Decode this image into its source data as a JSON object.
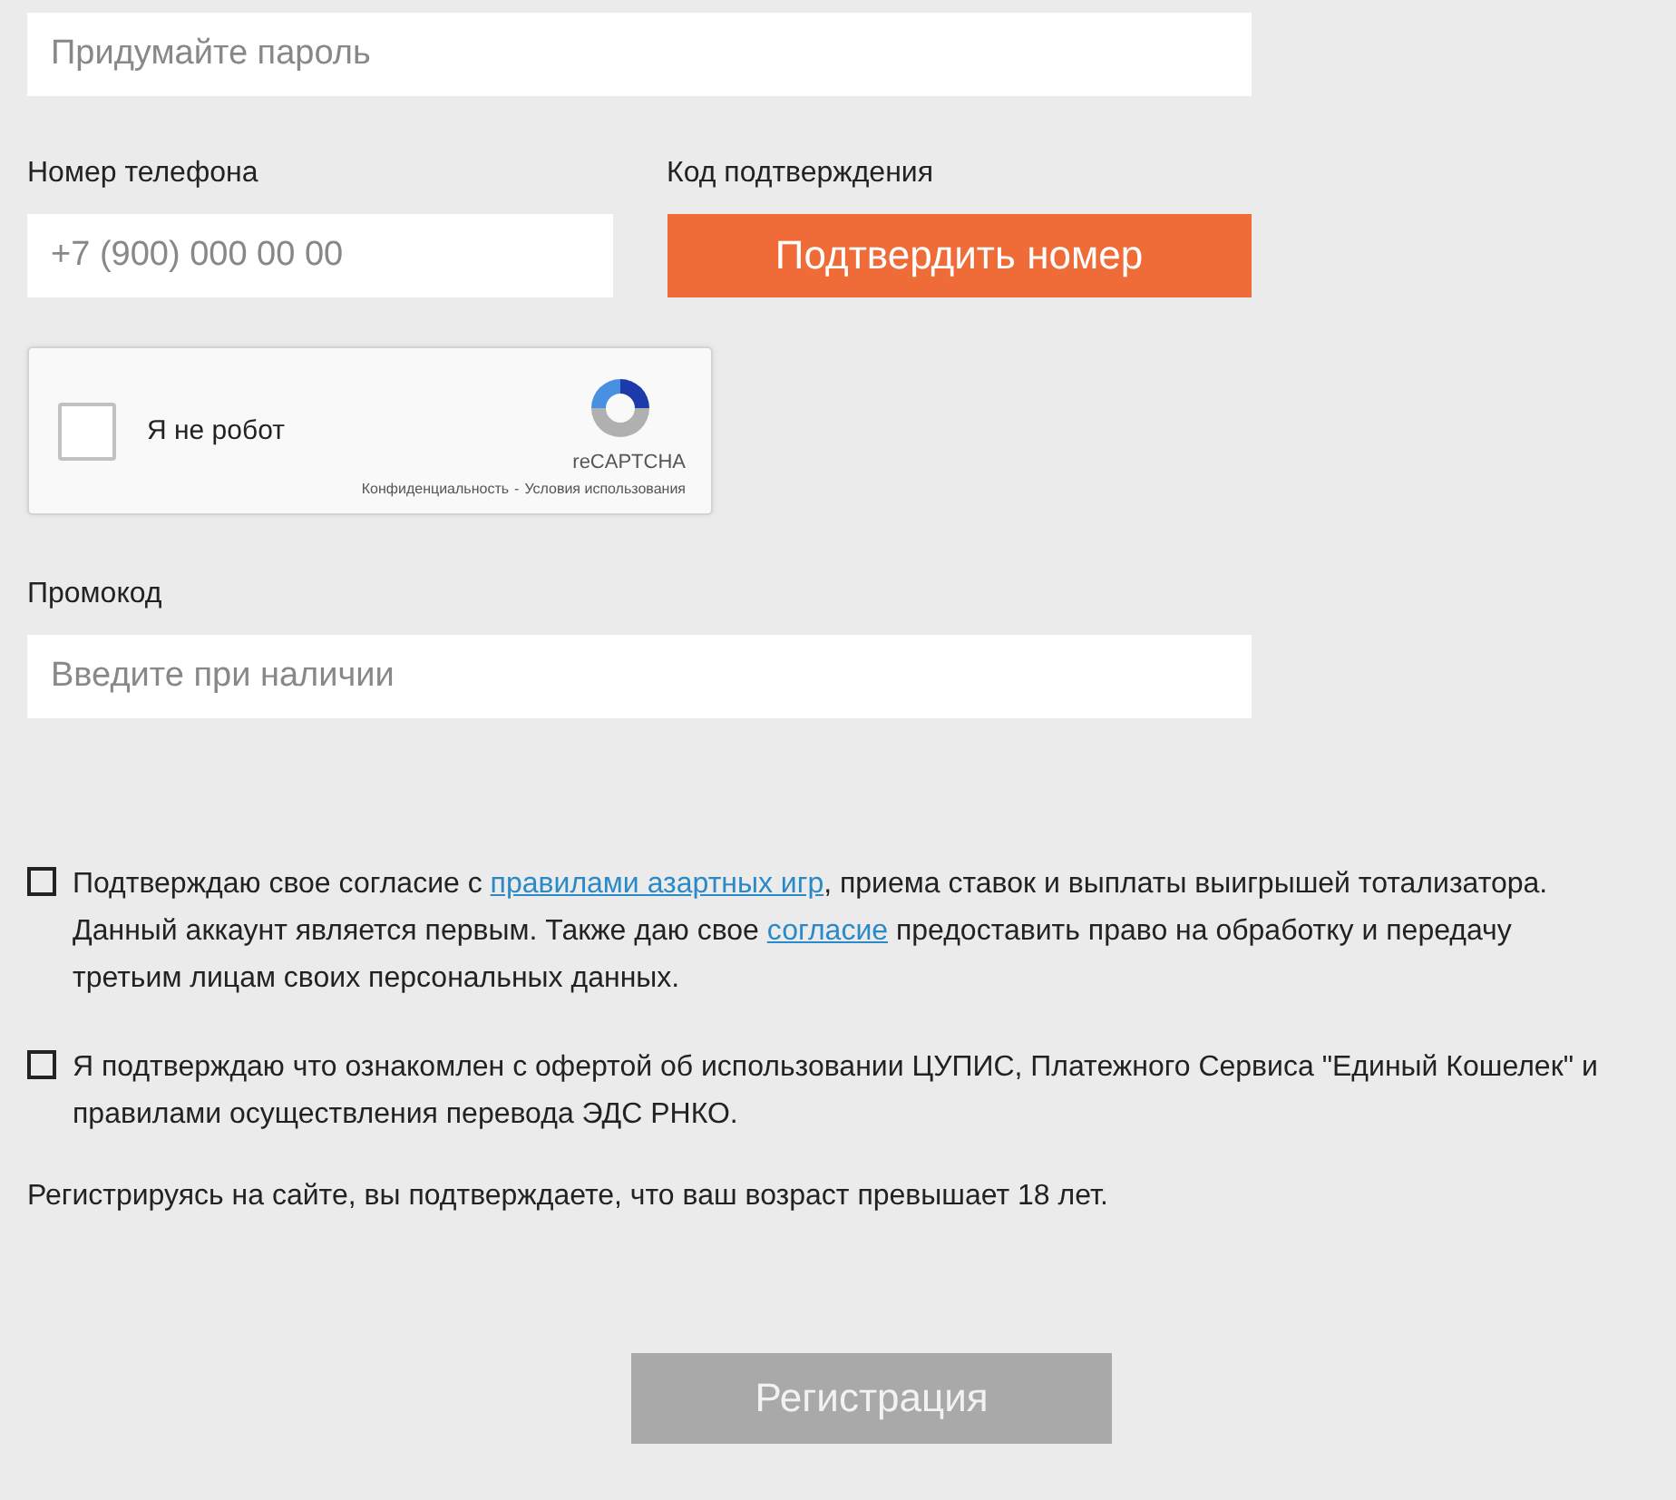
{
  "password": {
    "placeholder": "Придумайте пароль"
  },
  "phone": {
    "label": "Номер телефона",
    "placeholder": "+7 (900) 000 00 00"
  },
  "confirm": {
    "label": "Код подтверждения",
    "button": "Подтвердить номер"
  },
  "captcha": {
    "checked": false,
    "label": "Я не робот",
    "brand": "reCAPTCHA",
    "privacy": "Конфиденциальность",
    "separator": "-",
    "terms": "Условия использования"
  },
  "promo": {
    "label": "Промокод",
    "placeholder": "Введите при наличии"
  },
  "agreements": [
    {
      "checked": false,
      "parts": [
        {
          "kind": "text",
          "text": "Подтверждаю свое согласие с "
        },
        {
          "kind": "link",
          "text": "правилами азартных игр"
        },
        {
          "kind": "text",
          "text": ", приема ставок и выплаты выигрышей тотализатора. Данный аккаунт является первым. Также даю свое "
        },
        {
          "kind": "link",
          "text": "согласие"
        },
        {
          "kind": "text",
          "text": " предоставить право на обработку и передачу третьим лицам своих персональных данных."
        }
      ]
    },
    {
      "checked": false,
      "parts": [
        {
          "kind": "text",
          "text": "Я подтверждаю что ознакомлен с офертой об использовании ЦУПИС, Платежного Сервиса \"Единый Кошелек\" и правилами осуществления перевода ЭДС РНКО."
        }
      ]
    }
  ],
  "age_notice": "Регистрируясь на сайте, вы подтверждаете, что ваш возраст превышает 18 лет.",
  "submit": {
    "label": "Регистрация",
    "disabled": true
  }
}
